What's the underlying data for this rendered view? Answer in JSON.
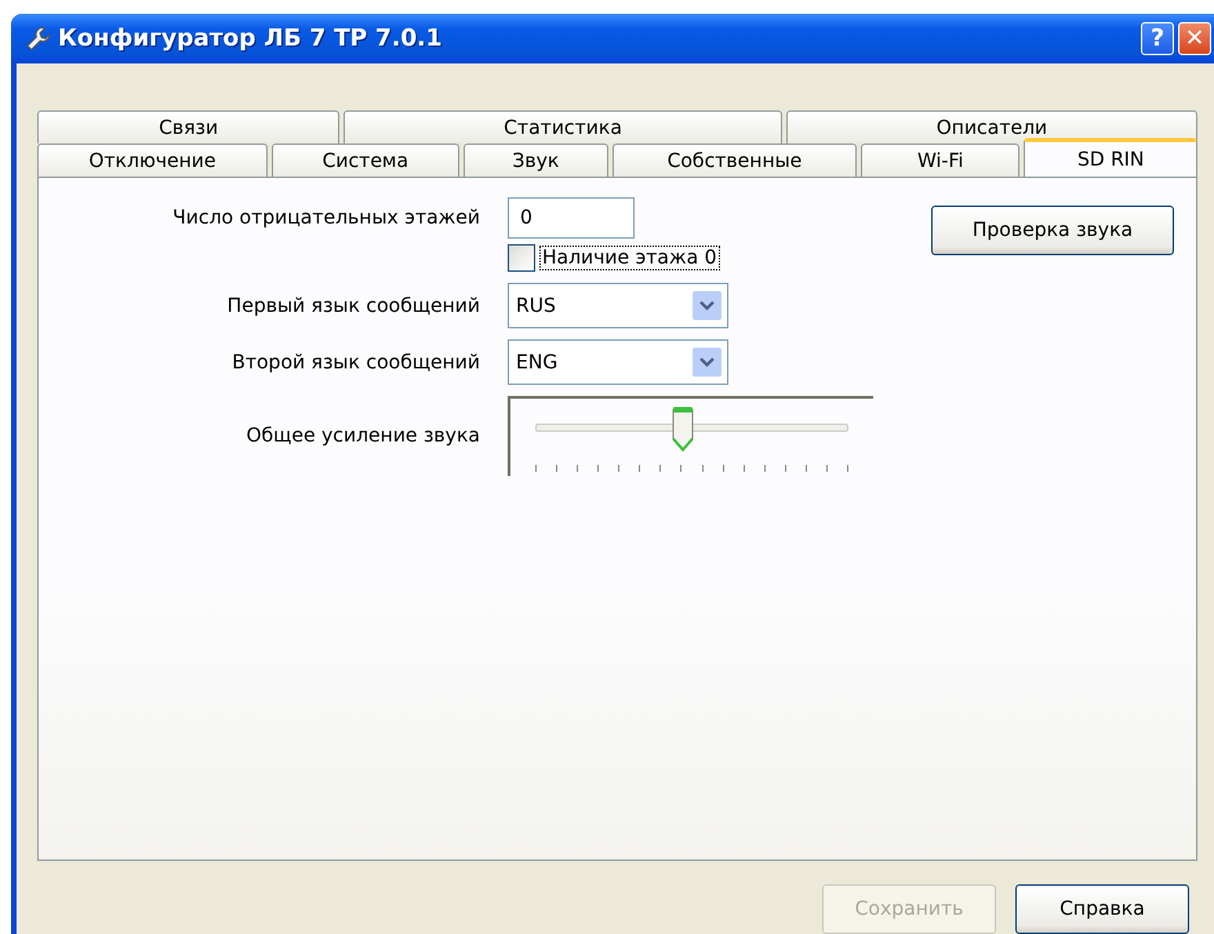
{
  "window": {
    "title": "Конфигуратор ЛБ 7 ТР 7.0.1",
    "buttons": [
      {
        "kind": "help",
        "label": "?"
      },
      {
        "kind": "close",
        "label": "✕"
      }
    ]
  },
  "tab_rows": [
    [
      {
        "label": "Связи",
        "selected": false
      },
      {
        "label": "Статистика",
        "selected": false
      },
      {
        "label": "Описатели",
        "selected": false
      }
    ],
    [
      {
        "label": "Отключение",
        "selected": false
      },
      {
        "label": "Система",
        "selected": false
      },
      {
        "label": "Звук",
        "selected": false
      },
      {
        "label": "Собственные",
        "selected": false
      },
      {
        "label": "Wi-Fi",
        "selected": false
      },
      {
        "label": "SD RIN",
        "selected": true
      }
    ]
  ],
  "form": {
    "negative_floors": {
      "label": "Число отрицательных этажей",
      "value": "0"
    },
    "floor_zero": {
      "label": "Наличие этажа 0",
      "checked": false
    },
    "first_language": {
      "label": "Первый язык сообщений",
      "value": "RUS"
    },
    "second_language": {
      "label": "Второй язык сообщений",
      "value": "ENG"
    },
    "gain": {
      "label": "Общее усиление звука",
      "level": 0.47
    },
    "sound_test_button": "Проверка звука"
  },
  "buttons": [
    {
      "label": "Сохранить",
      "disabled": true
    },
    {
      "label": "Справка",
      "disabled": false
    }
  ]
}
